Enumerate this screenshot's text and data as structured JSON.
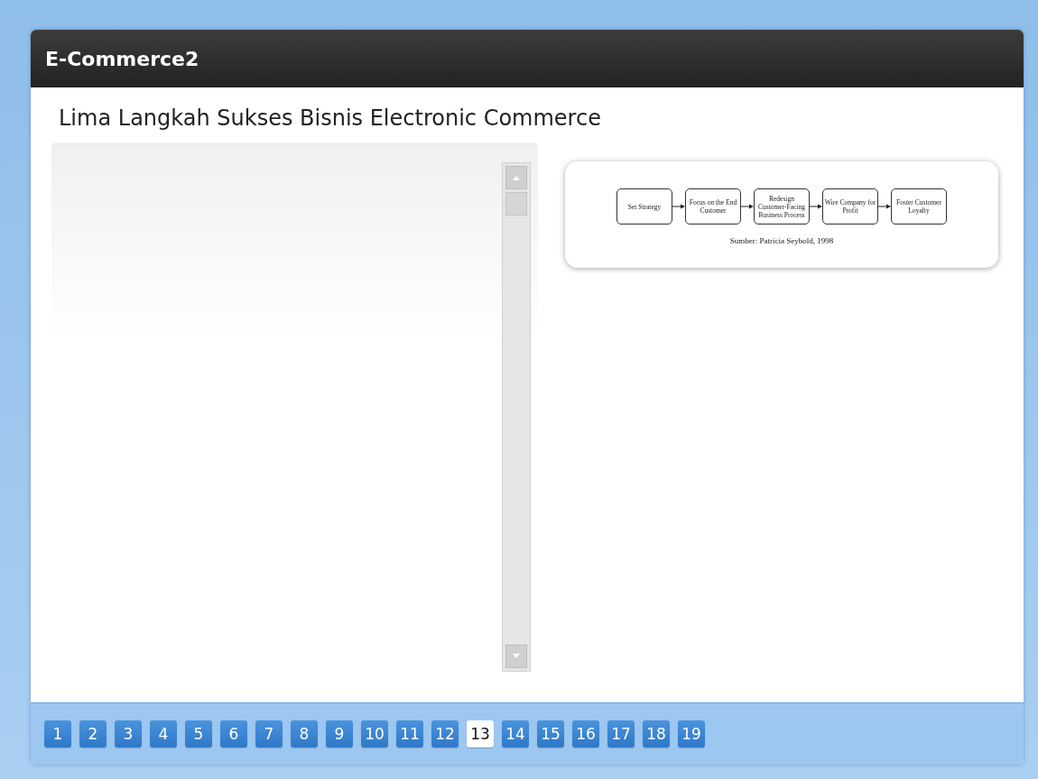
{
  "window": {
    "title": "E-Commerce2"
  },
  "heading": "Lima Langkah Sukses Bisnis Electronic Commerce",
  "figure": {
    "steps": [
      "Set Strategy",
      "Focus on the End Customer",
      "Redesign Customer-Facing Business Process",
      "Wire Company for Profit",
      "Foster Customer Loyalty"
    ],
    "caption": "Sumber: Patricia Seybold, 1998"
  },
  "pages": [
    {
      "label": "1",
      "selected": false
    },
    {
      "label": "2",
      "selected": false
    },
    {
      "label": "3",
      "selected": false
    },
    {
      "label": "4",
      "selected": false
    },
    {
      "label": "5",
      "selected": false
    },
    {
      "label": "6",
      "selected": false
    },
    {
      "label": "7",
      "selected": false
    },
    {
      "label": "8",
      "selected": false
    },
    {
      "label": "9",
      "selected": false
    },
    {
      "label": "10",
      "selected": false
    },
    {
      "label": "11",
      "selected": false
    },
    {
      "label": "12",
      "selected": false
    },
    {
      "label": "13",
      "selected": true
    },
    {
      "label": "14",
      "selected": false
    },
    {
      "label": "15",
      "selected": false
    },
    {
      "label": "16",
      "selected": false
    },
    {
      "label": "17",
      "selected": false
    },
    {
      "label": "18",
      "selected": false
    },
    {
      "label": "19",
      "selected": false
    }
  ]
}
